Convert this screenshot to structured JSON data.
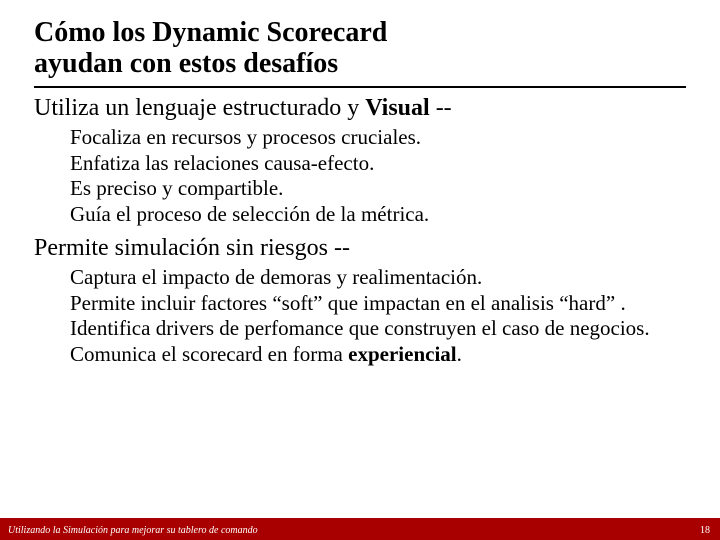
{
  "title_line1": "Cómo los Dynamic Scorecard",
  "title_line2": "ayudan con estos desafíos",
  "section1": {
    "lead_pre": "Utiliza un lenguaje estructurado y ",
    "lead_bold": "Visual",
    "lead_post": " --",
    "items": [
      "Focaliza en recursos y procesos cruciales.",
      "Enfatiza las relaciones causa-efecto.",
      "Es preciso y compartible.",
      "Guía el proceso de selección de la métrica."
    ]
  },
  "section2": {
    "lead": "Permite simulación sin riesgos --",
    "items": [
      "Captura el impacto de demoras y realimentación.",
      "Permite incluir factores “soft” que impactan en el analisis “hard” .",
      "Identifica drivers de perfomance que construyen el caso de negocios."
    ],
    "last_pre": "Comunica el scorecard en forma ",
    "last_bold": "experiencial",
    "last_post": "."
  },
  "footer": "Utilizando la Simulación para mejorar su tablero de comando",
  "page": "18"
}
